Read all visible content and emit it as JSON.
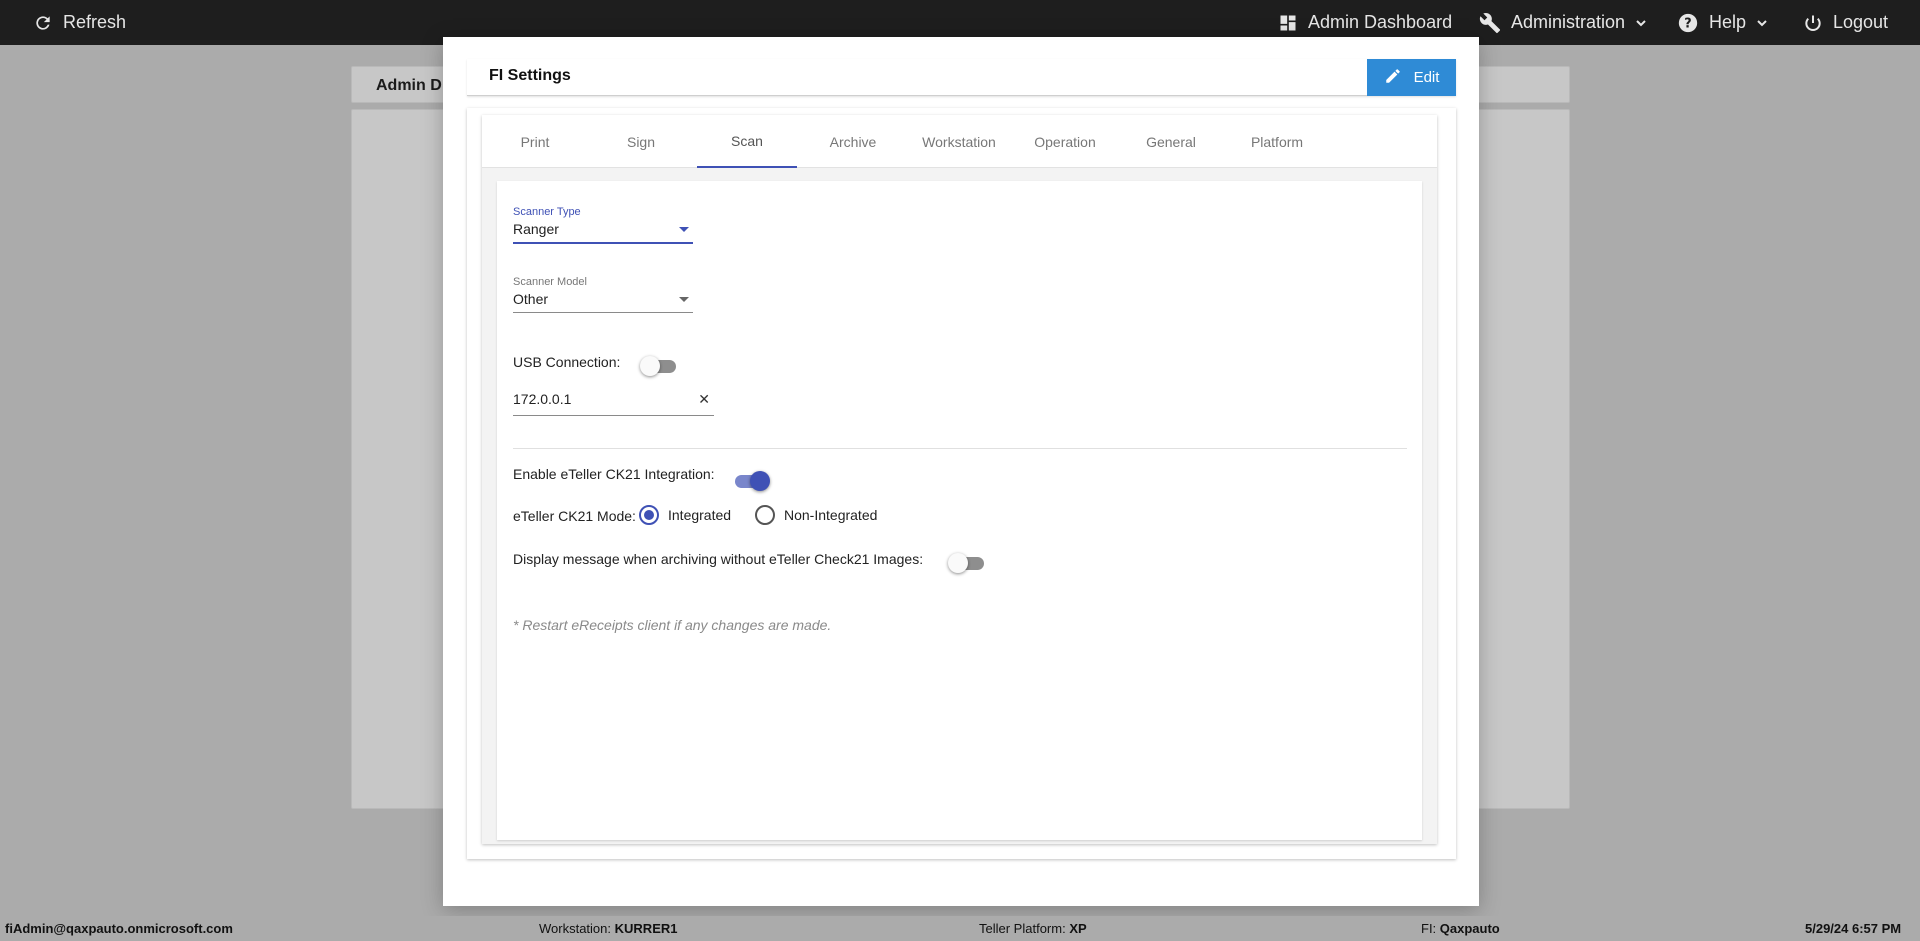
{
  "topbar": {
    "refresh": "Refresh",
    "admin_dashboard": "Admin Dashboard",
    "administration": "Administration",
    "help": "Help",
    "logout": "Logout"
  },
  "background": {
    "card_title": "Admin D"
  },
  "modal": {
    "title": "FI Settings",
    "edit_label": "Edit",
    "tabs": [
      "Print",
      "Sign",
      "Scan",
      "Archive",
      "Workstation",
      "Operation",
      "General",
      "Platform"
    ],
    "active_tab": "Scan",
    "scan": {
      "scanner_type_label": "Scanner Type",
      "scanner_type_value": "Ranger",
      "scanner_model_label": "Scanner Model",
      "scanner_model_value": "Other",
      "usb_connection_label": "USB Connection:",
      "usb_connection_on": false,
      "ip_address_value": "172.0.0.1",
      "ck21_integration_label": "Enable eTeller CK21 Integration:",
      "ck21_integration_on": true,
      "ck21_mode_label": "eTeller CK21 Mode:",
      "ck21_mode_options": [
        "Integrated",
        "Non-Integrated"
      ],
      "ck21_mode_selected": "Integrated",
      "display_message_label": "Display message when archiving without eTeller Check21 Images:",
      "display_message_on": false,
      "restart_note": "* Restart eReceipts client if any changes are made."
    }
  },
  "statusbar": {
    "user": "fiAdmin@qaxpauto.onmicrosoft.com",
    "workstation_label": "Workstation:",
    "workstation_value": "KURRER1",
    "platform_label": "Teller Platform:",
    "platform_value": "XP",
    "fi_label": "FI:",
    "fi_value": "Qaxpauto",
    "datetime": "5/29/24 6:57 PM"
  },
  "colors": {
    "topbar_bg": "#1e1e1e",
    "accent": "#3f51b5",
    "edit_button": "#2f8bd6",
    "overlay": "#ababab"
  }
}
